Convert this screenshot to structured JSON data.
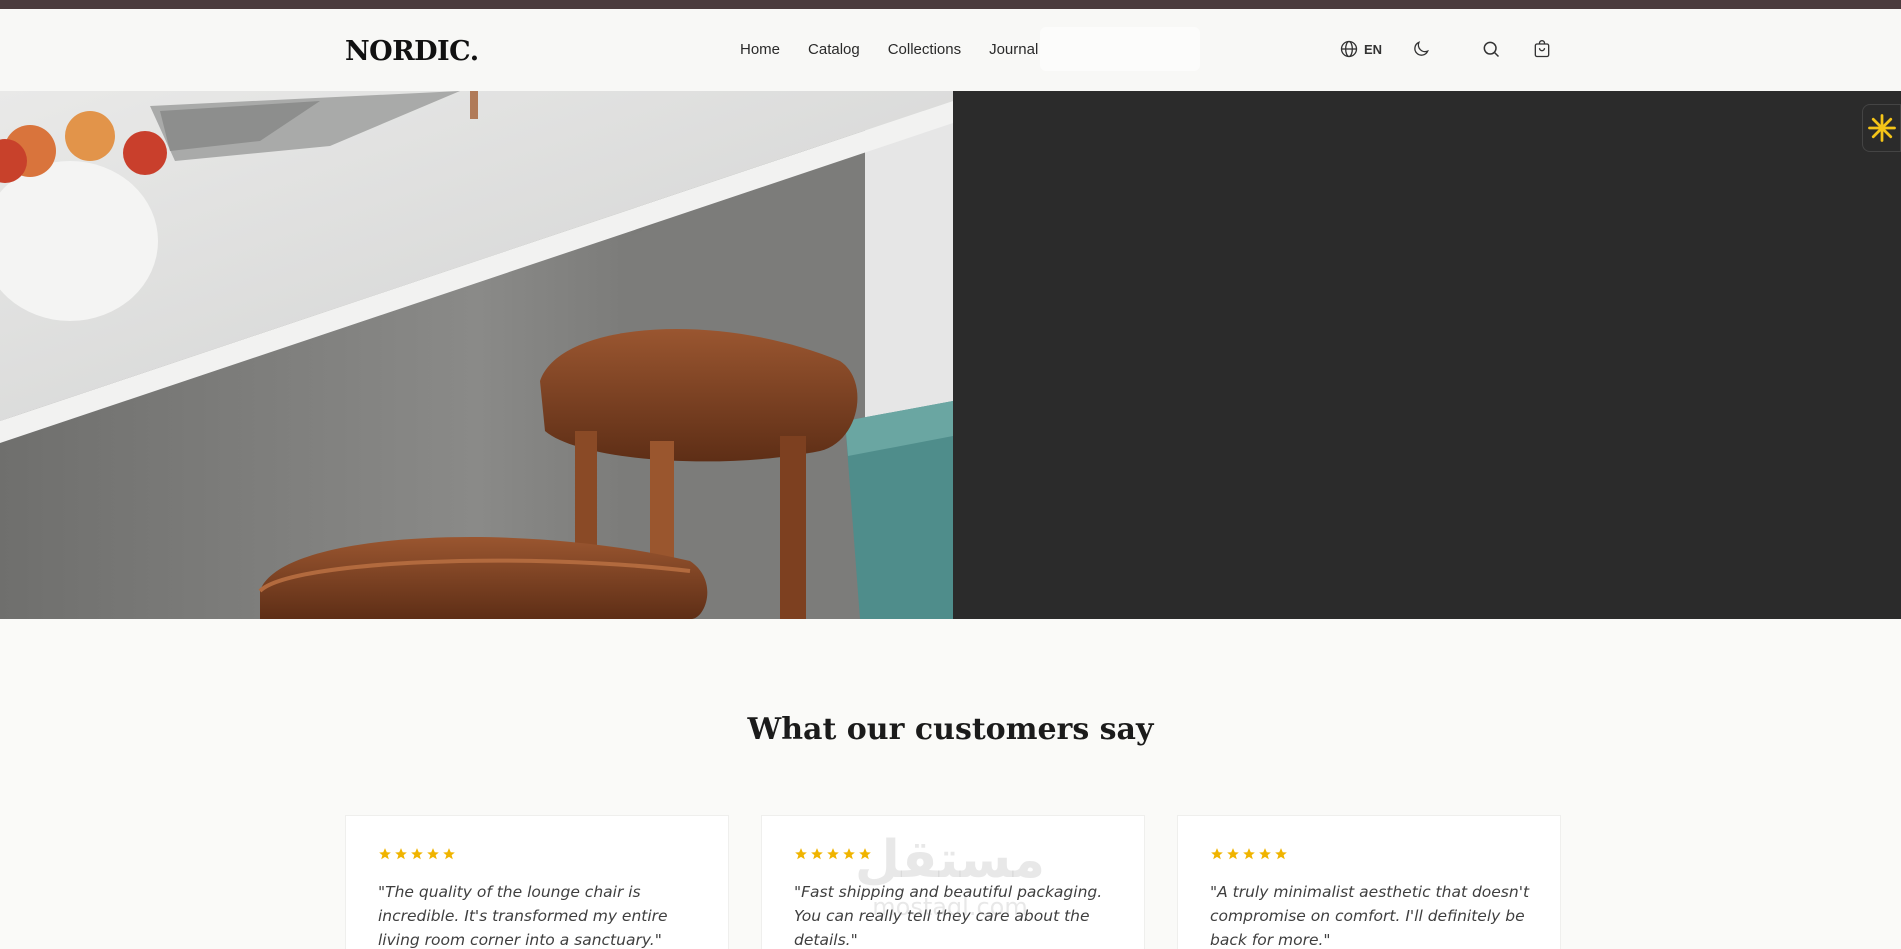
{
  "header": {
    "logo": "NORDIC.",
    "nav": [
      "Home",
      "Catalog",
      "Collections",
      "Journal"
    ],
    "language": "EN"
  },
  "icons": {
    "globe": "globe-icon",
    "moon": "moon-icon",
    "search": "search-icon",
    "cart": "shopping-bag-icon",
    "widget": "sparkle-icon"
  },
  "colors": {
    "topbar": "#4a3b3d",
    "hero_dark": "#2b2b2b",
    "star": "#f0b400",
    "widget_accent": "#f5c518"
  },
  "testimonials": {
    "title": "What our customers say",
    "items": [
      {
        "rating": 5,
        "quote": "\"The quality of the lounge chair is incredible. It's transformed my entire living room corner into a sanctuary.\""
      },
      {
        "rating": 5,
        "quote": "\"Fast shipping and beautiful packaging. You can really tell they care about the details.\""
      },
      {
        "rating": 5,
        "quote": "\"A truly minimalist aesthetic that doesn't compromise on comfort. I'll definitely be back for more.\""
      }
    ]
  },
  "watermark": {
    "text_ar": "مستقل",
    "text_en": "mostaql.com"
  }
}
